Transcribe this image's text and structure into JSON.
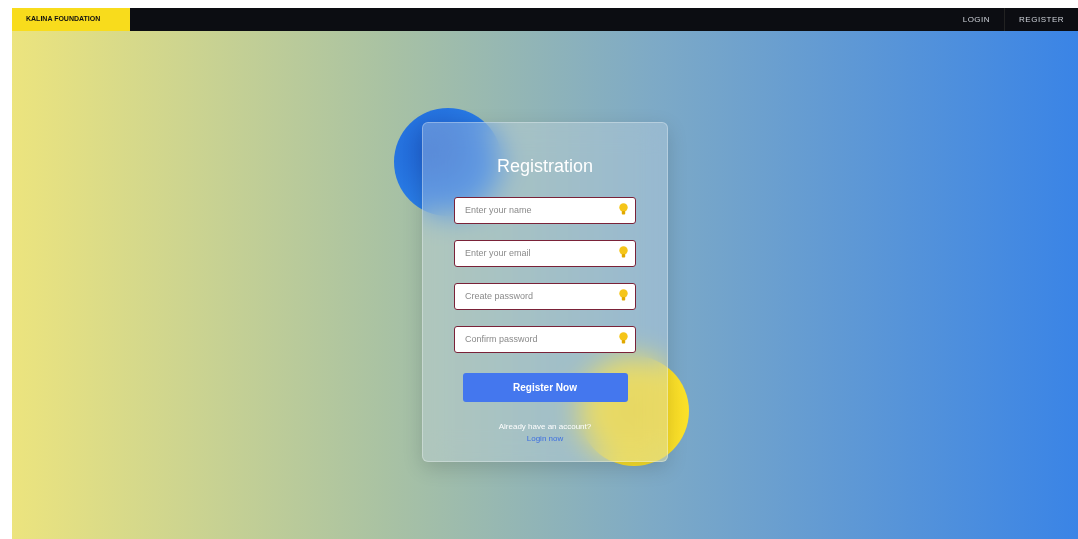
{
  "navbar": {
    "brand": "KALINA FOUNDATION",
    "links": [
      {
        "label": "LOGIN"
      },
      {
        "label": "REGISTER"
      }
    ]
  },
  "form": {
    "title": "Registration",
    "fields": [
      {
        "placeholder": "Enter your name"
      },
      {
        "placeholder": "Enter your email"
      },
      {
        "placeholder": "Create password"
      },
      {
        "placeholder": "Confirm password"
      }
    ],
    "submit": "Register Now",
    "prompt": "Already have an account?",
    "link": "Login now"
  }
}
